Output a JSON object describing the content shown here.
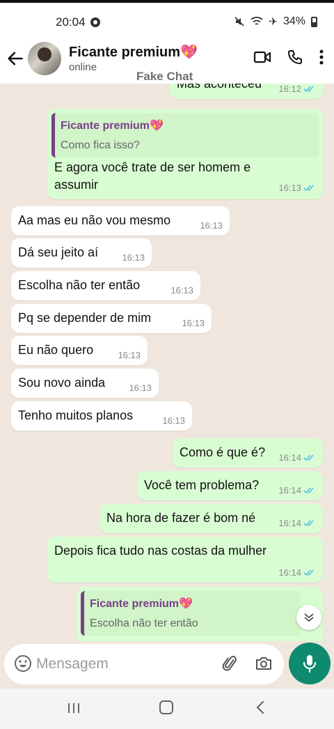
{
  "status_bar": {
    "time": "20:04",
    "battery": "34%"
  },
  "header": {
    "contact_name": "Ficante premium",
    "contact_emoji": "💖",
    "status": "online"
  },
  "watermark": "Fake Chat",
  "messages": [
    {
      "dir": "out",
      "text": "Mas aconteceu",
      "time": "16:12"
    },
    {
      "dir": "out",
      "quote_name": "Ficante premium💖",
      "quote_text": "Como fica isso?",
      "text_line1": "E agora você trate de ser homem e",
      "text_line2": "assumir",
      "time": "16:13"
    },
    {
      "dir": "in",
      "text": "Aa mas eu não vou mesmo",
      "time": "16:13"
    },
    {
      "dir": "in",
      "text": "Dá seu jeito aí",
      "time": "16:13"
    },
    {
      "dir": "in",
      "text": "Escolha não ter então",
      "time": "16:13"
    },
    {
      "dir": "in",
      "text": "Pq se depender de mim",
      "time": "16:13"
    },
    {
      "dir": "in",
      "text": "Eu não quero",
      "time": "16:13"
    },
    {
      "dir": "in",
      "text": "Sou novo ainda",
      "time": "16:13"
    },
    {
      "dir": "in",
      "text": "Tenho muitos planos",
      "time": "16:13"
    },
    {
      "dir": "out",
      "text": "Como é que é?",
      "time": "16:14"
    },
    {
      "dir": "out",
      "text": "Você tem problema?",
      "time": "16:14"
    },
    {
      "dir": "out",
      "text": "Na hora de fazer é bom né",
      "time": "16:14"
    },
    {
      "dir": "out",
      "text": "Depois fica tudo nas costas da mulher",
      "time": "16:14"
    },
    {
      "dir": "out",
      "quote_name": "Ficante premium💖",
      "quote_text": "Escolha não ter então"
    }
  ],
  "input": {
    "placeholder": "Mensagem"
  },
  "icons": [
    "back-arrow-icon",
    "video-call-icon",
    "phone-icon",
    "more-vert-icon",
    "emoji-icon",
    "attach-icon",
    "camera-icon",
    "mic-icon",
    "scroll-down-icon",
    "recent-apps-icon",
    "home-icon",
    "nav-back-icon"
  ],
  "colors": {
    "outgoing_bubble": "#d9fdd3",
    "incoming_bubble": "#ffffff",
    "chat_background": "#efe7de",
    "read_ticks": "#53bdeb",
    "quote_name": "#7b3f8a",
    "mic_button": "#0f8a6e"
  }
}
